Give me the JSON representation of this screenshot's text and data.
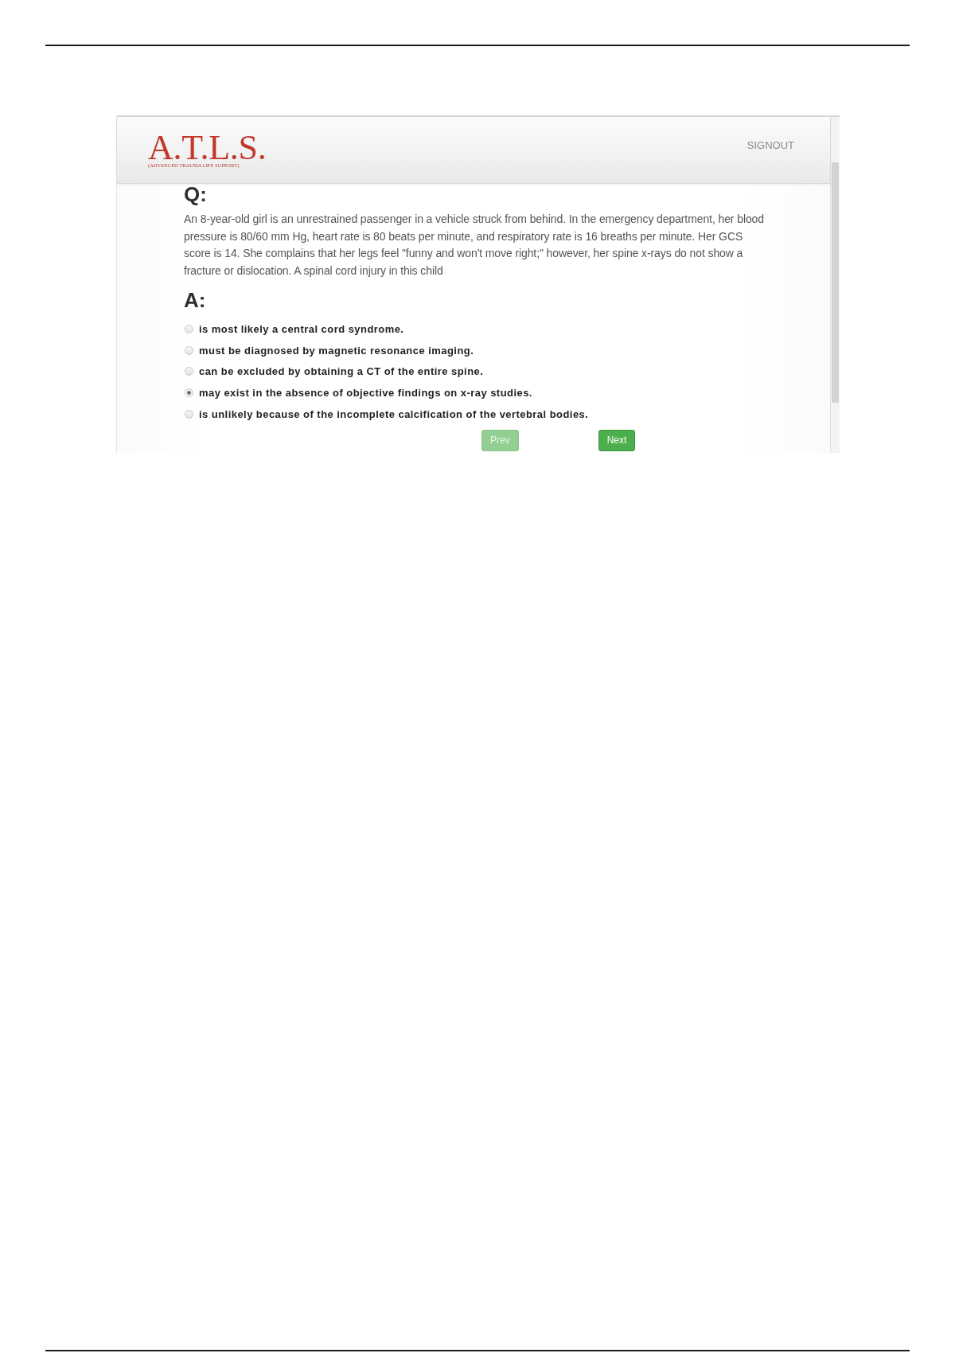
{
  "header": {
    "logo": "A.T.L.S.",
    "logo_subtitle": "(ADVANCED TRAUMA LIFE SUPPORT)",
    "signout": "SIGNOUT"
  },
  "question": {
    "label": "Q:",
    "text": "An 8-year-old girl is an unrestrained passenger in a vehicle struck from behind. In the emergency department, her blood pressure is 80/60 mm Hg, heart rate is 80 beats per minute, and respiratory rate is 16 breaths per minute. Her GCS score is 14. She complains that her legs feel \"funny and won't move right;\" however, her spine x-rays do not show a fracture or dislocation. A spinal cord injury in this child"
  },
  "answer": {
    "label": "A:",
    "options": [
      {
        "text": "is most likely a central cord syndrome.",
        "selected": false
      },
      {
        "text": "must be diagnosed by magnetic resonance imaging.",
        "selected": false
      },
      {
        "text": "can be excluded by obtaining a CT of the entire spine.",
        "selected": false
      },
      {
        "text": "may exist in the absence of objective findings on x-ray studies.",
        "selected": true
      },
      {
        "text": "is unlikely because of the incomplete calcification of the vertebral bodies.",
        "selected": false
      }
    ]
  },
  "buttons": [
    {
      "label": "Prev",
      "disabled": true
    },
    {
      "label": "Next",
      "disabled": false
    }
  ]
}
